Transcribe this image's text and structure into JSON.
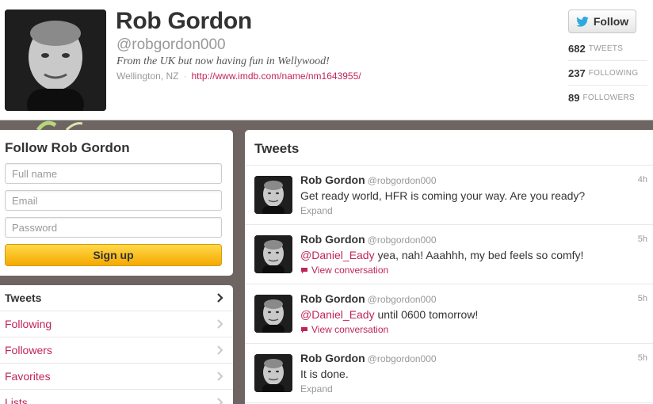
{
  "profile": {
    "name": "Rob Gordon",
    "handle": "@robgordon000",
    "bio": "From the UK but now having fun in Wellywood!",
    "location": "Wellington, NZ",
    "url": "http://www.imdb.com/name/nm1643955/",
    "follow_label": "Follow"
  },
  "stats": [
    {
      "num": "682",
      "label": "TWEETS"
    },
    {
      "num": "237",
      "label": "FOLLOWING"
    },
    {
      "num": "89",
      "label": "FOLLOWERS"
    }
  ],
  "follow_module": {
    "title": "Follow Rob Gordon",
    "fullname_placeholder": "Full name",
    "email_placeholder": "Email",
    "password_placeholder": "Password",
    "signup_label": "Sign up"
  },
  "nav": [
    {
      "label": "Tweets",
      "active": true
    },
    {
      "label": "Following"
    },
    {
      "label": "Followers"
    },
    {
      "label": "Favorites"
    },
    {
      "label": "Lists"
    }
  ],
  "timeline": {
    "title": "Tweets",
    "tweets": [
      {
        "name": "Rob Gordon",
        "handle": "@robgordon000",
        "time": "4h",
        "mention": "",
        "text": "Get ready world, HFR is coming your way. Are you ready?",
        "action": "Expand"
      },
      {
        "name": "Rob Gordon",
        "handle": "@robgordon000",
        "time": "5h",
        "mention": "@Daniel_Eady",
        "text": " yea, nah! Aaahhh, my bed feels so comfy!",
        "action": "View conversation"
      },
      {
        "name": "Rob Gordon",
        "handle": "@robgordon000",
        "time": "5h",
        "mention": "@Daniel_Eady",
        "text": " until 0600 tomorrow!",
        "action": "View conversation"
      },
      {
        "name": "Rob Gordon",
        "handle": "@robgordon000",
        "time": "5h",
        "mention": "",
        "text": "It is done.",
        "action": "Expand"
      }
    ]
  },
  "colors": {
    "link": "#c0245c",
    "background": "#6e6563",
    "twitter_bird": "#2fa9e0",
    "signup": "#f5a900"
  },
  "icons": {
    "follow": "twitter-bird-icon",
    "nav": "chevron-right-icon",
    "conversation": "speech-bubble-icon"
  }
}
